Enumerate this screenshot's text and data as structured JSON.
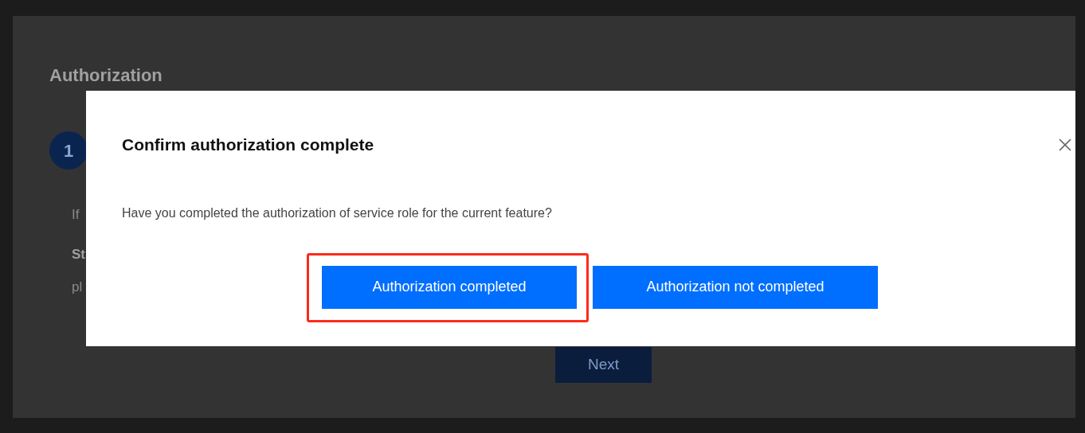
{
  "page": {
    "title": "Authorization",
    "step": {
      "number": "1"
    },
    "fragments": [
      {
        "kind": "body",
        "text": "If"
      },
      {
        "kind": "heading",
        "text": "St"
      },
      {
        "kind": "body",
        "text": "pl"
      }
    ],
    "next_button": "Next"
  },
  "dialog": {
    "title": "Confirm authorization complete",
    "message": "Have you completed the authorization of service role for the current feature?",
    "buttons": [
      {
        "label": "Authorization completed",
        "highlighted": true
      },
      {
        "label": "Authorization not completed",
        "highlighted": false
      }
    ]
  }
}
